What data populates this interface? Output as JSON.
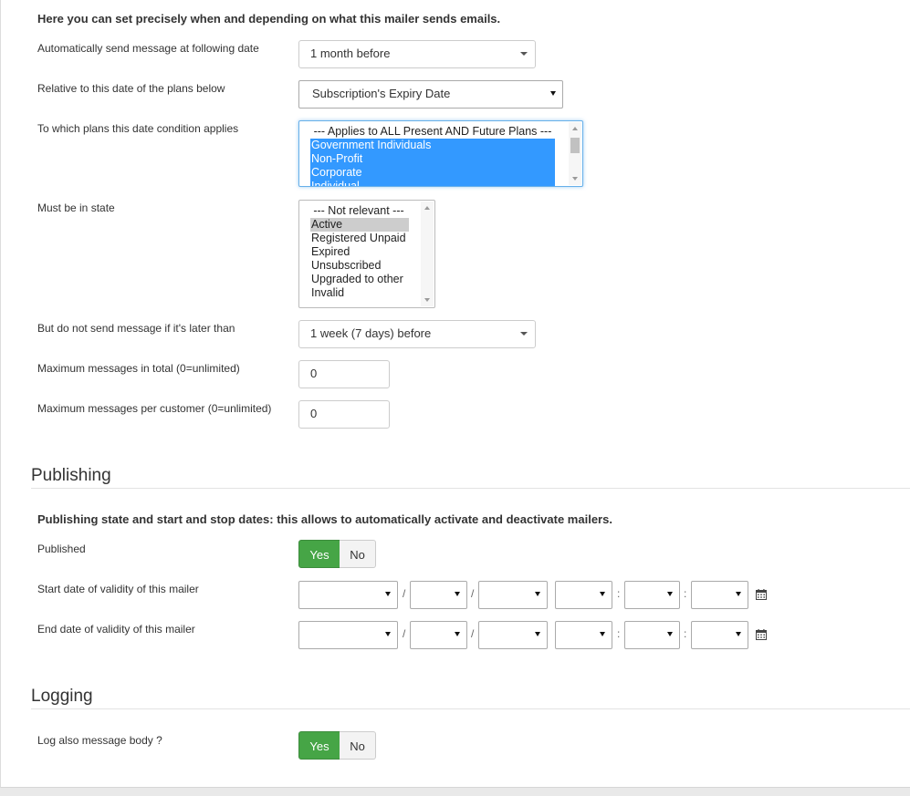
{
  "intro": "Here you can set precisely when and depending on what this mailer sends emails.",
  "fields": {
    "send_date": {
      "label": "Automatically send message at following date",
      "value": "1 month before"
    },
    "relative": {
      "label": "Relative to this date of the plans below",
      "value": "Subscription's Expiry Date"
    },
    "plans": {
      "label": "To which plans this date condition applies",
      "options": [
        "--- Applies to ALL Present AND Future Plans ---",
        "Government Individuals",
        "Non-Profit",
        "Corporate",
        "Individual"
      ],
      "selected": [
        "Government Individuals",
        "Non-Profit",
        "Corporate",
        "Individual"
      ]
    },
    "state": {
      "label": "Must be in state",
      "options": [
        "--- Not relevant ---",
        "Active",
        "Registered Unpaid",
        "Expired",
        "Unsubscribed",
        "Upgraded to other",
        "Invalid"
      ],
      "selected": [
        "Active"
      ]
    },
    "later_than": {
      "label": "But do not send message if it's later than",
      "value": "1 week (7 days) before"
    },
    "max_total": {
      "label": "Maximum messages in total (0=unlimited)",
      "value": "0"
    },
    "max_customer": {
      "label": "Maximum messages per customer (0=unlimited)",
      "value": "0"
    }
  },
  "publishing": {
    "title": "Publishing",
    "intro": "Publishing state and start and stop dates: this allows to automatically activate and deactivate mailers.",
    "published": {
      "label": "Published",
      "yes": "Yes",
      "no": "No",
      "active": "Yes"
    },
    "start": {
      "label": "Start date of validity of this mailer"
    },
    "end": {
      "label": "End date of validity of this mailer"
    },
    "date_sep": "/",
    "time_sep": ":"
  },
  "logging": {
    "title": "Logging",
    "log_body": {
      "label": "Log also message body ?",
      "yes": "Yes",
      "no": "No",
      "active": "Yes"
    }
  },
  "colors": {
    "toggle_active": "#46a546",
    "selected_option": "#3399ff",
    "focus_border": "#66afe9"
  }
}
